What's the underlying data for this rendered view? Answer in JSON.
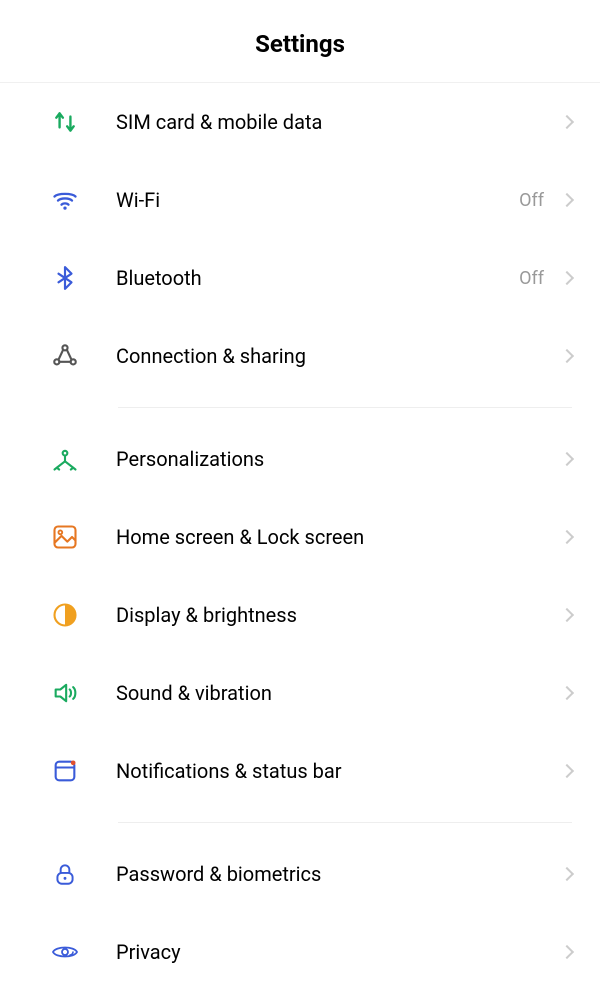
{
  "header": {
    "title": "Settings"
  },
  "groups": [
    {
      "items": [
        {
          "id": "sim",
          "label": "SIM card & mobile data",
          "value": ""
        },
        {
          "id": "wifi",
          "label": "Wi-Fi",
          "value": "Off"
        },
        {
          "id": "bluetooth",
          "label": "Bluetooth",
          "value": "Off"
        },
        {
          "id": "connection",
          "label": "Connection & sharing",
          "value": ""
        }
      ]
    },
    {
      "items": [
        {
          "id": "personalization",
          "label": "Personalizations",
          "value": ""
        },
        {
          "id": "homescreen",
          "label": "Home screen & Lock screen",
          "value": ""
        },
        {
          "id": "display",
          "label": "Display & brightness",
          "value": ""
        },
        {
          "id": "sound",
          "label": "Sound & vibration",
          "value": ""
        },
        {
          "id": "notifications",
          "label": "Notifications & status bar",
          "value": ""
        }
      ]
    },
    {
      "items": [
        {
          "id": "password",
          "label": "Password & biometrics",
          "value": ""
        },
        {
          "id": "privacy",
          "label": "Privacy",
          "value": ""
        }
      ]
    }
  ]
}
